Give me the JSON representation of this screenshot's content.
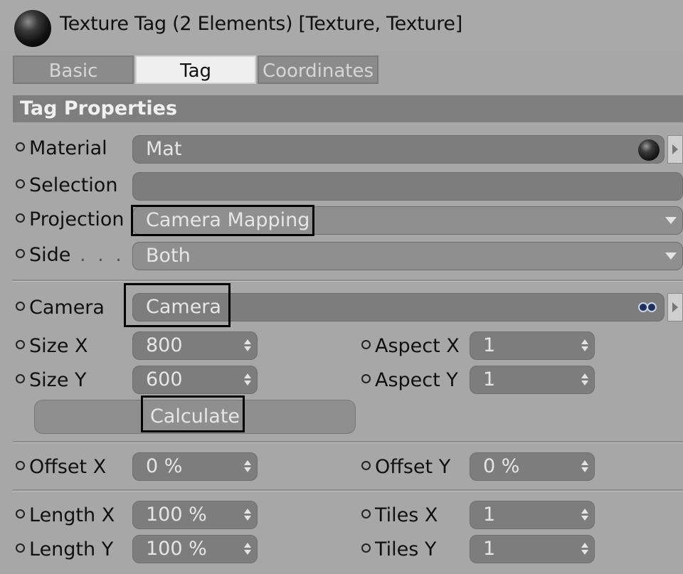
{
  "window": {
    "title": "Texture Tag (2 Elements) [Texture, Texture]",
    "icon": "texture-tag-ball-icon"
  },
  "tabs": [
    {
      "label": "Basic",
      "active": false
    },
    {
      "label": "Tag",
      "active": true
    },
    {
      "label": "Coordinates",
      "active": false
    }
  ],
  "section": {
    "title": "Tag Properties"
  },
  "fields": {
    "material": {
      "label": "Material",
      "value": "Mat"
    },
    "selection": {
      "label": "Selection",
      "value": ""
    },
    "projection": {
      "label": "Projection",
      "value": "Camera Mapping"
    },
    "side": {
      "label": "Side",
      "value": "Both"
    },
    "camera": {
      "label": "Camera",
      "value": "Camera"
    },
    "size_x": {
      "label": "Size X",
      "value": "800"
    },
    "size_y": {
      "label": "Size Y",
      "value": "600"
    },
    "aspect_x": {
      "label": "Aspect X",
      "value": "1"
    },
    "aspect_y": {
      "label": "Aspect Y",
      "value": "1"
    },
    "offset_x": {
      "label": "Offset X",
      "value": "0 %"
    },
    "offset_y": {
      "label": "Offset Y",
      "value": "0 %"
    },
    "length_x": {
      "label": "Length X",
      "value": "100 %"
    },
    "length_y": {
      "label": "Length Y",
      "value": "100 %"
    },
    "tiles_x": {
      "label": "Tiles X",
      "value": "1"
    },
    "tiles_y": {
      "label": "Tiles Y",
      "value": "1"
    }
  },
  "buttons": {
    "calculate": "Calculate"
  }
}
